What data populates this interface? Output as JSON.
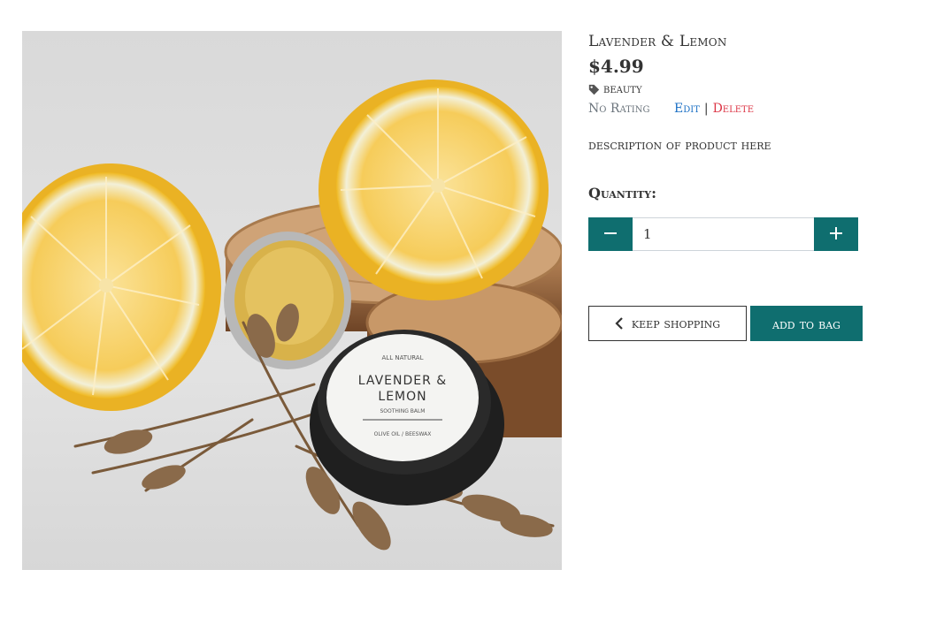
{
  "product": {
    "name": "Lavender & Lemon",
    "price": "$4.99",
    "category": "beauty",
    "rating": "No Rating",
    "edit_label": "Edit",
    "separator": "|",
    "delete_label": "Delete",
    "description": "description of product here",
    "image": {
      "jar_label_top": "ALL NATURAL",
      "jar_label_line1": "LAVENDER &",
      "jar_label_line2": "LEMON",
      "jar_label_sub": "SOOTHING BALM",
      "jar_label_bottom": "OLIVE OIL / BEESWAX"
    }
  },
  "quantity": {
    "label": "Quantity:",
    "value": "1"
  },
  "actions": {
    "keep_shopping": "keep shopping",
    "add_to_bag": "add to bag"
  },
  "icons": {
    "tag": "tag-icon",
    "minus": "minus-icon",
    "plus": "plus-icon",
    "back": "chevron-left-icon"
  },
  "colors": {
    "accent": "#0f6e6f",
    "edit_link": "#1a6fc4",
    "delete_link": "#dc3545",
    "muted": "#6c757d",
    "text": "#333333"
  }
}
